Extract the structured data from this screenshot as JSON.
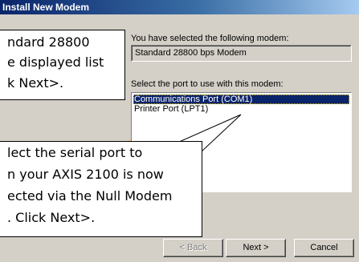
{
  "window": {
    "title": "Install New Modem"
  },
  "dialog": {
    "selected_modem_label": "You have selected the following modem:",
    "selected_modem_value": "Standard 28800 bps Modem",
    "port_label": "Select the port to use with this modem:",
    "ports": [
      {
        "label": "Communications Port (COM1)",
        "selected": true
      },
      {
        "label": "Printer Port (LPT1)",
        "selected": false
      }
    ],
    "buttons": {
      "back": "< Back",
      "next": "Next >",
      "cancel": "Cancel"
    }
  },
  "callout_top": {
    "lines": [
      "ndard 28800",
      "e displayed list",
      "k Next>."
    ]
  },
  "callout_bottom": {
    "lines": [
      "lect the serial port to",
      "n your AXIS 2100 is now",
      "ected via the Null Modem",
      ". Click Next>."
    ]
  },
  "colors": {
    "title_gradient_start": "#0a246a",
    "selection": "#0a246a",
    "dialog_face": "#d4d0c8"
  }
}
